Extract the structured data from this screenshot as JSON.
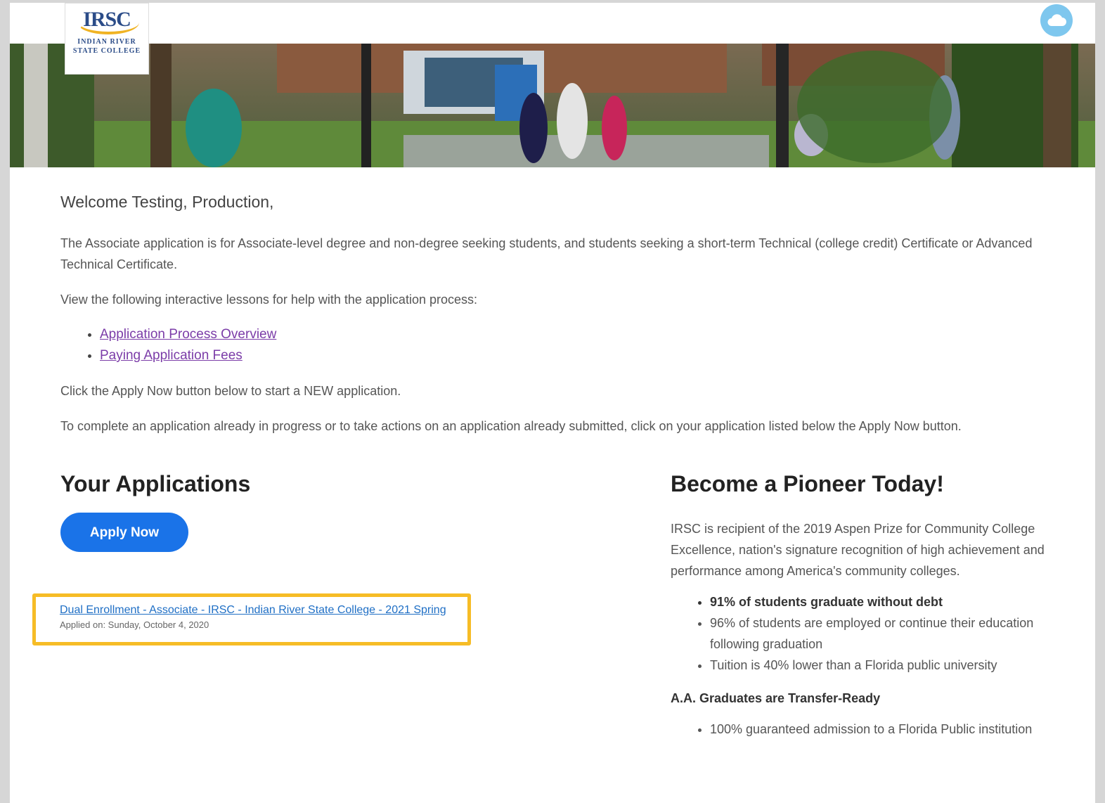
{
  "header": {
    "logo": {
      "mark": "IRSC",
      "line1": "INDIAN RIVER",
      "line2": "STATE COLLEGE"
    },
    "cloud_icon": "cloud-icon"
  },
  "welcome": "Welcome Testing, Production,",
  "intro": "The Associate application is for Associate-level degree and non-degree seeking students, and students seeking a short-term Technical (college credit) Certificate or Advanced Technical Certificate.",
  "lessons_intro": "View the following interactive lessons for help with the application process:",
  "lessons": [
    {
      "label": "Application Process Overview"
    },
    {
      "label": "Paying Application Fees"
    }
  ],
  "apply_hint": "Click the Apply Now button below to start a NEW application.",
  "complete_hint": "To complete an application already in progress or to take actions on an application already submitted, click on your application listed below the Apply Now button.",
  "applications": {
    "heading": "Your Applications",
    "apply_button": "Apply Now",
    "items": [
      {
        "title": "Dual Enrollment - Associate - IRSC - Indian River State College - 2021 Spring",
        "applied": "Applied on: Sunday, October 4, 2020"
      }
    ],
    "highlight_color": "#f6bc26"
  },
  "pioneer": {
    "heading": "Become a Pioneer Today!",
    "text": "IRSC is recipient of the 2019 Aspen Prize for Community College Excellence, nation's signature recognition of high achievement and performance among America's community colleges.",
    "bullets": [
      "91% of students graduate without debt",
      "96% of students are employed or continue their education following graduation",
      "Tuition is 40% lower than a Florida public university"
    ],
    "subheading": "A.A. Graduates are Transfer-Ready",
    "bullets2": [
      "100% guaranteed admission to a Florida Public institution"
    ]
  },
  "colors": {
    "accent": "#1a73e8",
    "link": "#1f6fc5",
    "visited_link": "#7b3ca8"
  }
}
